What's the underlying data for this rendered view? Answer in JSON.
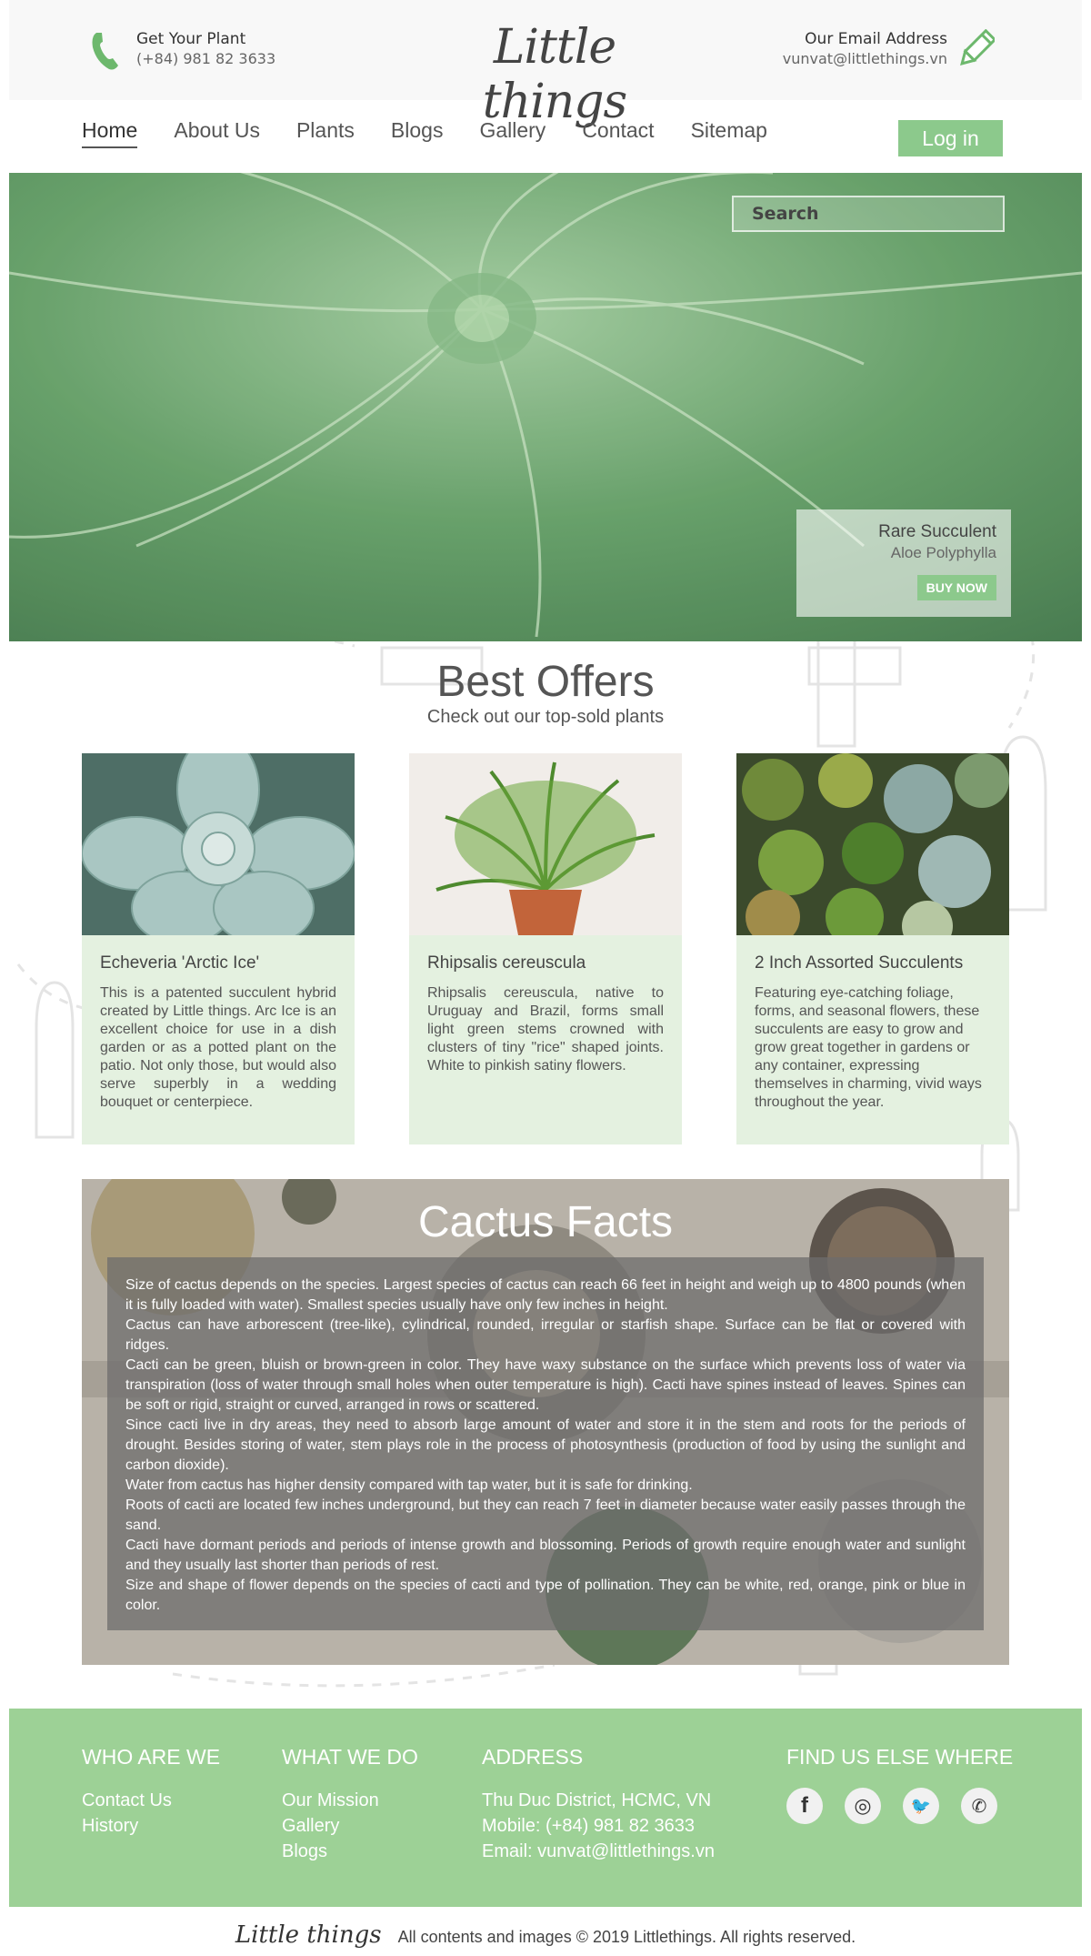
{
  "header": {
    "phone_label": "Get Your Plant",
    "phone_number": "(+84) 981 82 3633",
    "logo_text": "Little things",
    "email_label": "Our Email Address",
    "email_address": "vunvat@littlethings.vn",
    "icons": [
      "phone-icon",
      "pencil-icon"
    ]
  },
  "nav": {
    "items": [
      "Home",
      "About Us",
      "Plants",
      "Blogs",
      "Gallery",
      "Contact",
      "Sitemap"
    ],
    "active": "Home",
    "login_label": "Log in"
  },
  "hero": {
    "search_placeholder": "Search",
    "plant_name": "Rare Succulent",
    "plant_species": "Aloe Polyphylla",
    "buy_label": "BUY NOW"
  },
  "offers": {
    "title": "Best Offers",
    "subtitle": "Check out our top-sold plants",
    "cards": [
      {
        "name": "Echeveria 'Arctic Ice'",
        "desc": "This is a patented succulent hybrid created by Little things. Arc Ice is an excellent choice for use in a dish garden or as a potted plant on the patio. Not only those, but would also serve superbly in a wedding bouquet or centerpiece."
      },
      {
        "name": "Rhipsalis cereuscula",
        "desc": "Rhipsalis cereuscula, native to Uruguay and Brazil, forms small light green stems crowned with clusters of tiny \"rice\" shaped joints. White to pinkish satiny flowers."
      },
      {
        "name": "2 Inch Assorted Succulents",
        "desc": "Featuring eye-catching foliage, forms, and seasonal flowers, these succulents are easy to grow and grow great together in gardens or any container, expressing themselves in charming, vivid ways throughout the year."
      }
    ]
  },
  "facts": {
    "title": "Cactus Facts",
    "items": [
      "Size of cactus depends on the species. Largest species of cactus can reach 66 feet in height and weigh up to 4800 pounds (when it is fully loaded with water). Smallest species usually have only few inches in height.",
      "Cactus can have arborescent (tree-like), cylindrical, rounded, irregular or starfish shape. Surface can be flat or covered with ridges.",
      "Cacti can be green, bluish or brown-green in color. They have waxy substance on the surface which prevents loss of water via transpiration (loss of water through small holes when outer temperature is high). Cacti have spines instead of leaves. Spines can be soft or rigid, straight or curved, arranged in rows or scattered.",
      "Since cacti live in dry areas, they need to absorb large amount of water and store it in the stem and roots for the periods of drought. Besides storing of water, stem plays role in the process of photosynthesis (production of food by using the sunlight and carbon dioxide).",
      "Water from cactus has higher density compared with tap water, but it is safe for drinking.",
      "Roots of cacti are located few inches underground, but they can reach 7 feet in diameter because water easily passes through the sand.",
      "Cacti have dormant periods and periods of intense growth and blossoming. Periods of growth require enough water and sunlight and they usually last shorter than periods of rest.",
      "Size and shape of flower depends on the species of cacti and type of pollination. They can be white, red, orange, pink or blue in color."
    ]
  },
  "footer": {
    "who": {
      "title": "WHO ARE WE",
      "links": [
        "Contact Us",
        "History"
      ]
    },
    "what": {
      "title": "WHAT WE DO",
      "links": [
        "Our Mission",
        "Gallery",
        "Blogs"
      ]
    },
    "address": {
      "title": "ADDRESS",
      "lines": [
        "Thu Duc District, HCMC, VN",
        "Mobile: (+84) 981 82 3633",
        "Email: vunvat@littlethings.vn"
      ]
    },
    "social": {
      "title": "FIND US ELSE WHERE",
      "icons": [
        "facebook-icon",
        "instagram-icon",
        "twitter-icon",
        "whatsapp-icon"
      ],
      "glyphs": [
        "f",
        "◎",
        "🐦",
        "✆"
      ]
    }
  },
  "copyright": {
    "logo_text": "Little things",
    "text": "All contents and images © 2019 Littlethings. All rights reserved."
  },
  "colors": {
    "accent_green": "#8cc98c",
    "footer_green": "#9dd196",
    "card_bg": "#e4f1e0",
    "text_dark": "#444444"
  }
}
